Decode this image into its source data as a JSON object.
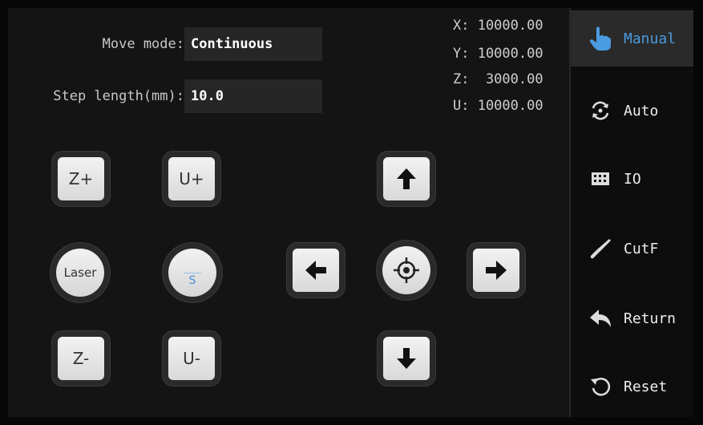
{
  "settings": {
    "move_mode_label": "Move mode:",
    "move_mode_value": "Continuous",
    "step_length_label": "Step length(mm):",
    "step_length_value": "10.0"
  },
  "coordinates": {
    "x": "X: 10000.00",
    "y": "Y: 10000.00",
    "z": "Z:  3000.00",
    "u": "U: 10000.00"
  },
  "buttons": {
    "z_plus": "Z+",
    "u_plus": "U+",
    "laser": "Laser",
    "fs_top": "F",
    "fs_bottom": "S",
    "z_minus": "Z-",
    "u_minus": "U-"
  },
  "sidebar": {
    "items": [
      {
        "label": "Manual",
        "icon": "hand-pointer-icon",
        "active": true
      },
      {
        "label": "Auto",
        "icon": "auto-cycle-icon",
        "active": false
      },
      {
        "label": "IO",
        "icon": "io-grid-icon",
        "active": false
      },
      {
        "label": "CutF",
        "icon": "knife-icon",
        "active": false
      },
      {
        "label": "Return",
        "icon": "return-arrow-icon",
        "active": false
      },
      {
        "label": "Reset",
        "icon": "reset-icon",
        "active": false
      }
    ]
  },
  "colors": {
    "accent": "#4a9be0",
    "background": "#141414"
  }
}
